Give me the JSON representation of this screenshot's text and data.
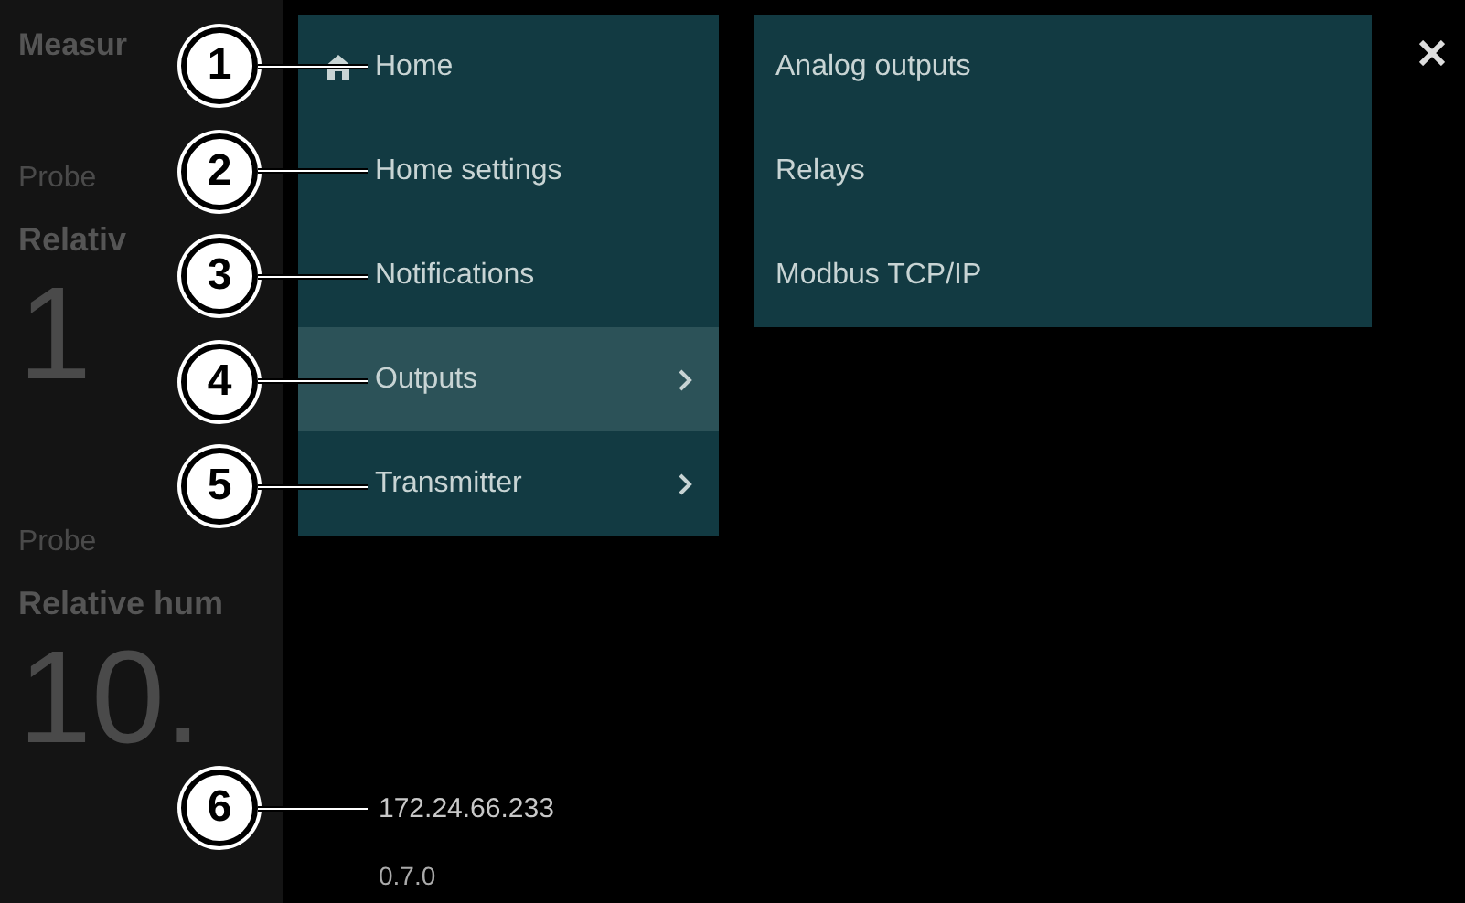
{
  "background": {
    "title": "Measur",
    "probes": [
      {
        "label": "Probe",
        "quantity": "Relativ",
        "value": "1"
      },
      {
        "label": "Probe",
        "quantity": "Relative hum",
        "value": "10."
      }
    ]
  },
  "menu": {
    "items": [
      {
        "label": "Home",
        "kind": "home",
        "selected": false,
        "submenu": false,
        "callout": "1"
      },
      {
        "label": "Home settings",
        "kind": "plain",
        "selected": false,
        "submenu": false,
        "callout": "2"
      },
      {
        "label": "Notifications",
        "kind": "plain",
        "selected": false,
        "submenu": false,
        "callout": "3"
      },
      {
        "label": "Outputs",
        "kind": "plain",
        "selected": true,
        "submenu": true,
        "callout": "4"
      },
      {
        "label": "Transmitter",
        "kind": "plain",
        "selected": false,
        "submenu": true,
        "callout": "5"
      }
    ]
  },
  "submenu": {
    "items": [
      "Analog outputs",
      "Relays",
      "Modbus TCP/IP"
    ]
  },
  "footer": {
    "ip_address": "172.24.66.233",
    "version": "0.7.0",
    "callout": "6"
  }
}
